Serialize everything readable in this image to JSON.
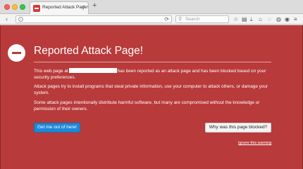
{
  "tab": {
    "title": "Reported Attack Page!",
    "close_glyph": "×",
    "new_tab_glyph": "+"
  },
  "navbar": {
    "back_glyph": "‹",
    "url_value": "",
    "reload_glyph": "⟳",
    "search_placeholder": "Search",
    "icons": [
      "search-icon",
      "star-icon",
      "reading-list-icon",
      "download-icon",
      "home-icon",
      "pocket-icon",
      "menu-icon"
    ]
  },
  "warning": {
    "heading": "Reported Attack Page!",
    "para1_before": "This web page at",
    "para1_after": "has been reported as an attack page and has been blocked based on your security preferences.",
    "para2": "Attack pages try to install programs that steal private information, use your computer to attack others, or damage your system.",
    "para3": "Some attack pages intentionally distribute harmful software, but many are compromised without the knowledge or permission of their owners.",
    "primary_button": "Get me out of here!",
    "secondary_button": "Why was this page blocked?",
    "ignore_link": "Ignore this warning"
  },
  "colors": {
    "page_background": "#b93a3a",
    "primary_button": "#1e88d8",
    "text": "#ffffff"
  }
}
